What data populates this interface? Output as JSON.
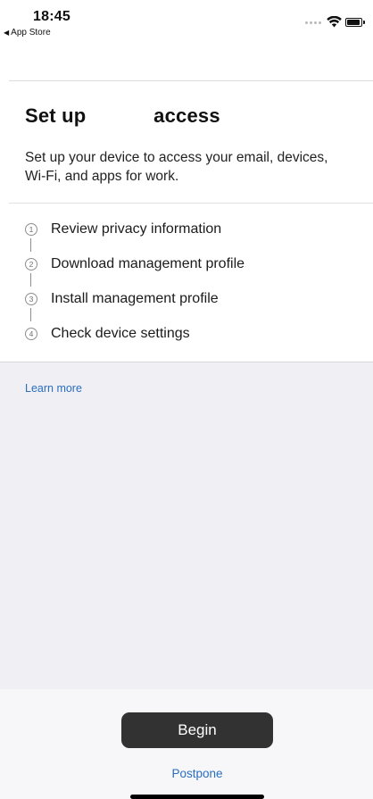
{
  "status_bar": {
    "time": "18:45",
    "back_label": "App Store",
    "icons": [
      "cellular-signal-icon",
      "wifi-icon",
      "battery-icon"
    ]
  },
  "header": {
    "title": "Set up            access"
  },
  "intro": {
    "text": "Set up your device to access your email, devices, Wi-Fi, and apps for work."
  },
  "steps": [
    {
      "number": "1",
      "label": "Review privacy information"
    },
    {
      "number": "2",
      "label": "Download management profile"
    },
    {
      "number": "3",
      "label": "Install management profile"
    },
    {
      "number": "4",
      "label": "Check device settings"
    }
  ],
  "links": {
    "learn_more": "Learn more",
    "postpone": "Postpone"
  },
  "footer": {
    "begin_label": "Begin"
  },
  "colors": {
    "accent_link": "#2a6ebd",
    "primary_button": "#323232",
    "content_background": "#efeff4"
  }
}
